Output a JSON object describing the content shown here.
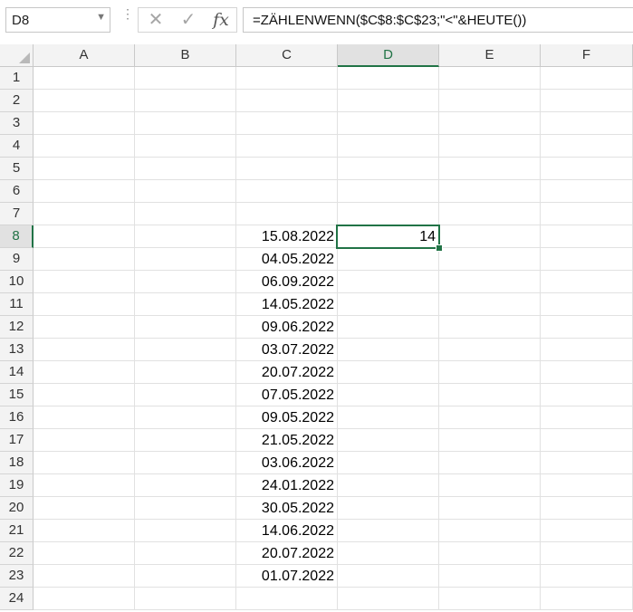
{
  "formula_bar": {
    "name_box": "D8",
    "formula": "=ZÄHLENWENN($C$8:$C$23;\"<\"&HEUTE())",
    "cancel_icon": "cancel-x-icon",
    "enter_icon": "checkmark-icon",
    "fx_label": "fx"
  },
  "sheet": {
    "columns": [
      "A",
      "B",
      "C",
      "D",
      "E",
      "F"
    ],
    "active_column": "D",
    "rows": [
      1,
      2,
      3,
      4,
      5,
      6,
      7,
      8,
      9,
      10,
      11,
      12,
      13,
      14,
      15,
      16,
      17,
      18,
      19,
      20,
      21,
      22,
      23,
      24
    ],
    "active_row": 8,
    "selected_cell": "D8",
    "accent_color": "#217346",
    "cells": [
      {
        "row": 8,
        "col": "C",
        "value": "15.08.2022"
      },
      {
        "row": 8,
        "col": "D",
        "value": "14"
      },
      {
        "row": 9,
        "col": "C",
        "value": "04.05.2022"
      },
      {
        "row": 10,
        "col": "C",
        "value": "06.09.2022"
      },
      {
        "row": 11,
        "col": "C",
        "value": "14.05.2022"
      },
      {
        "row": 12,
        "col": "C",
        "value": "09.06.2022"
      },
      {
        "row": 13,
        "col": "C",
        "value": "03.07.2022"
      },
      {
        "row": 14,
        "col": "C",
        "value": "20.07.2022"
      },
      {
        "row": 15,
        "col": "C",
        "value": "07.05.2022"
      },
      {
        "row": 16,
        "col": "C",
        "value": "09.05.2022"
      },
      {
        "row": 17,
        "col": "C",
        "value": "21.05.2022"
      },
      {
        "row": 18,
        "col": "C",
        "value": "03.06.2022"
      },
      {
        "row": 19,
        "col": "C",
        "value": "24.01.2022"
      },
      {
        "row": 20,
        "col": "C",
        "value": "30.05.2022"
      },
      {
        "row": 21,
        "col": "C",
        "value": "14.06.2022"
      },
      {
        "row": 22,
        "col": "C",
        "value": "20.07.2022"
      },
      {
        "row": 23,
        "col": "C",
        "value": "01.07.2022"
      }
    ]
  }
}
